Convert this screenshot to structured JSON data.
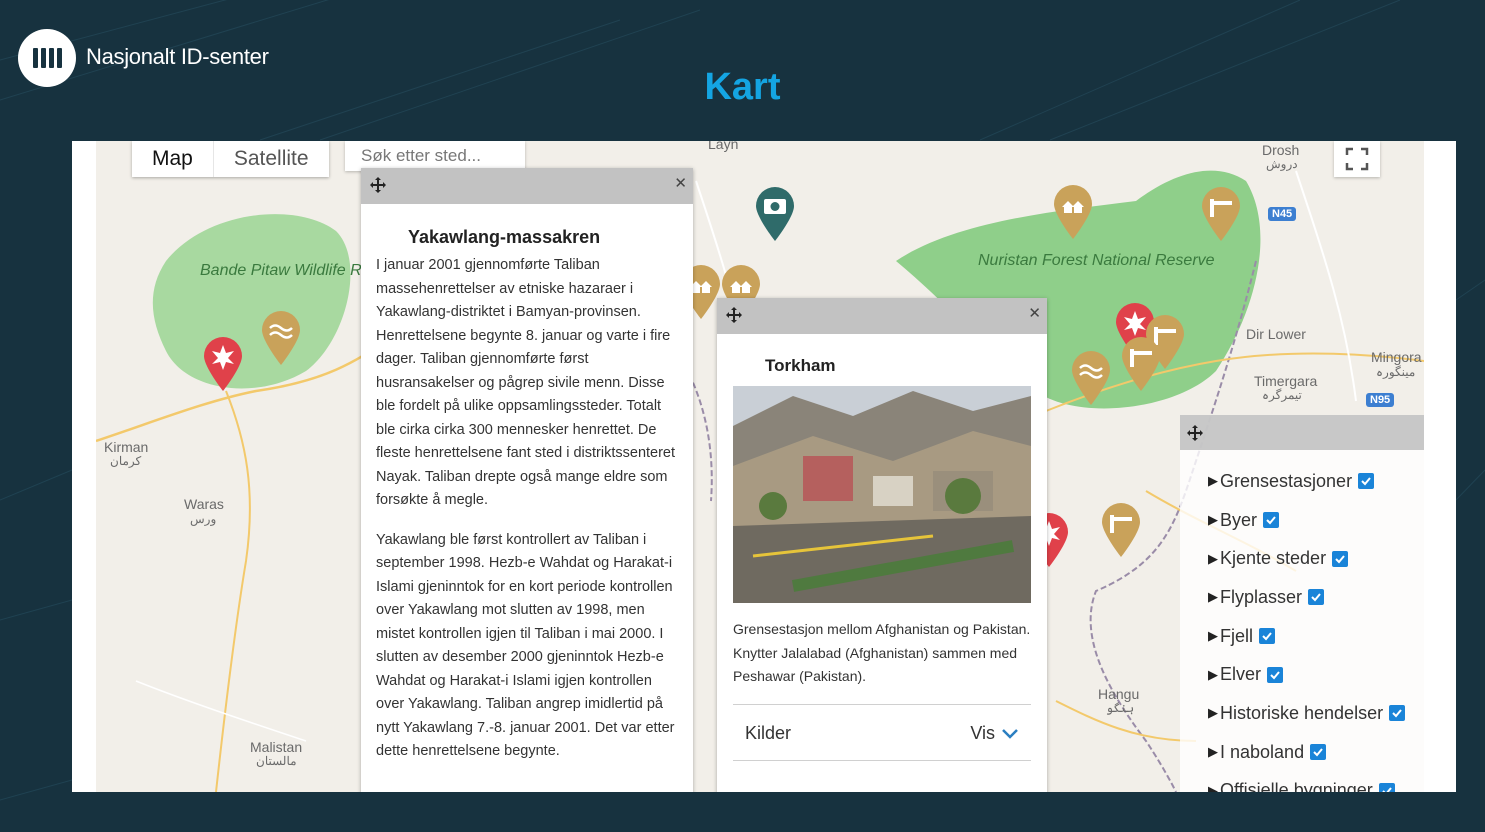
{
  "header": {
    "brand": "Nasjonalt ID-senter",
    "page_title": "Kart"
  },
  "map": {
    "type_buttons": [
      "Map",
      "Satellite"
    ],
    "search": {
      "placeholder": "Søk etter sted..."
    },
    "labels": {
      "bande_pitaw": "Bande Pitaw Wildlife Refuge",
      "nuristan": "Nuristan Forest National Reserve",
      "kirman": "Kirman",
      "kirman_local": "کرمان",
      "waras": "Waras",
      "waras_local": "ورس",
      "malistan": "Malistan",
      "malistan_local": "مالستان",
      "drosh": "Drosh",
      "drosh_local": "دروش",
      "dir_lower": "Dir Lower",
      "timergara": "Timergara",
      "timergara_local": "تیمرگرہ",
      "mingora": "Mingora",
      "mingora_local": "مینگورہ",
      "hangu": "Hangu",
      "hangu_local": "ہنگو",
      "layn": "Layn",
      "n45": "N45",
      "n95": "N95"
    },
    "icons": [
      "camera-icon",
      "house-icon",
      "gate-icon",
      "star-icon",
      "river-icon"
    ]
  },
  "popup_yakawlang": {
    "title": "Yakawlang-massakren",
    "paragraph1": "I januar 2001 gjennomførte Taliban massehenrettelser av etniske hazaraer i Yakawlang-distriktet i Bamyan-provinsen. Henrettelsene begynte 8. januar og varte i fire dager. Taliban gjennomførte først husransakelser og pågrep sivile menn. Disse ble fordelt på ulike oppsamlingssteder. Totalt ble cirka cirka 300 mennesker henrettet. De fleste henrettelsene fant sted i distriktssenteret Nayak. Taliban drepte også mange eldre som forsøkte å megle.",
    "paragraph2": "Yakawlang ble først kontrollert av Taliban i september 1998. Hezb-e Wahdat og Harakat-i Islami gjeninntok for en kort periode kontrollen over Yakawlang mot slutten av 1998, men mistet kontrollen igjen til Taliban i mai 2000. I slutten av desember 2000 gjeninntok Hezb-e Wahdat og Harakat-i Islami igjen kontrollen over Yakawlang. Taliban angrep imidlertid på nytt Yakawlang 7.-8. januar 2001. Det var etter dette henrettelsene begynte."
  },
  "popup_torkham": {
    "title": "Torkham",
    "description": "Grensestasjon mellom Afghanistan og Pakistan. Knytter Jalalabad (Afghanistan) sammen med Peshawar (Pakistan).",
    "sources_label": "Kilder",
    "sources_toggle": "Vis"
  },
  "layers_panel": {
    "items": [
      {
        "label": "Grensestasjoner",
        "checked": true
      },
      {
        "label": "Byer",
        "checked": true
      },
      {
        "label": "Kjente steder",
        "checked": true
      },
      {
        "label": "Flyplasser",
        "checked": true
      },
      {
        "label": "Fjell",
        "checked": true
      },
      {
        "label": "Elver",
        "checked": true
      },
      {
        "label": "Historiske hendelser",
        "checked": true
      },
      {
        "label": "I naboland",
        "checked": true
      },
      {
        "label": "Offisielle bygninger",
        "checked": true
      }
    ]
  },
  "colors": {
    "background": "#17323f",
    "title_blue": "#14a5e3",
    "pin_gold": "#c9a25a",
    "pin_red": "#e0414a",
    "pin_teal": "#2f6b6a",
    "park_green": "#8fcf8a",
    "checkbox_blue": "#1a84d8"
  }
}
